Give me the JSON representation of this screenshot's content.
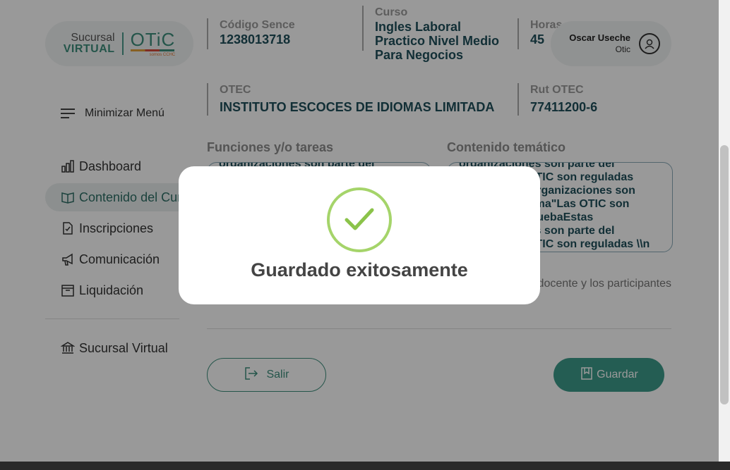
{
  "logo": {
    "line1": "Sucursal",
    "line2": "VIRTUAL",
    "brand": "OTiC",
    "sub": "somos CCHC"
  },
  "sidebar": {
    "minimize_label": "Minimizar Menú",
    "items": [
      {
        "label": "Dashboard",
        "icon": "bar-chart-icon"
      },
      {
        "label": "Contenido del Curso",
        "icon": "book-icon"
      },
      {
        "label": "Inscripciones",
        "icon": "document-check-icon"
      },
      {
        "label": "Comunicación",
        "icon": "megaphone-icon"
      },
      {
        "label": "Liquidación",
        "icon": "archive-box-icon"
      }
    ],
    "bottom_item": {
      "label": "Sucursal Virtual",
      "icon": "bank-icon"
    }
  },
  "course_info": {
    "codigo_label": "Código Sence",
    "codigo_value": "1238013718",
    "curso_label": "Curso",
    "curso_value": "Ingles Laboral Practico Nivel Medio Para Negocios",
    "horas_label": "Horas",
    "horas_value": "45",
    "otec_label": "OTEC",
    "otec_value": "INSTITUTO ESCOCES DE IDIOMAS LIMITADA",
    "rut_label": "Rut OTEC",
    "rut_value": "77411200-6"
  },
  "user": {
    "name": "Oscar Useche",
    "role": "Otic"
  },
  "funciones": {
    "label": "Funciones y/o tareas",
    "lines": [
      "organizaciones son parte del sistema"
    ]
  },
  "contenido": {
    "label": "Contenido temático",
    "lines": [
      "organizaciones son parte del",
      "sistema.Las OTIC son reguladas",
      "pruebaEstas organizaciones son",
      "parte del sistema\"Las OTIC son",
      "reguladas \\npruebaEstas",
      "organizaciones son parte del",
      "sistema.Las OTIC son reguladas \\\\n"
    ]
  },
  "helper_text": "Las actividades de la empresa, el docente y los participantes",
  "buttons": {
    "salir": "Salir",
    "guardar": "Guardar"
  },
  "modal": {
    "title": "Guardado exitosamente"
  },
  "colors": {
    "accent": "#3d9b8a",
    "success": "#a5d46a",
    "title": "#1f4f5a"
  }
}
